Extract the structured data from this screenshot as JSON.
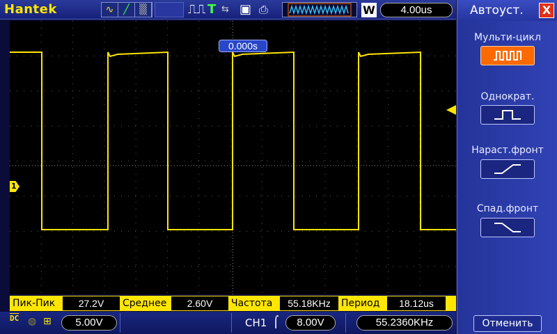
{
  "header": {
    "brand": "Hantek",
    "timebase": "4.00us",
    "wave_mode": "W",
    "icons": [
      "waveform-icon",
      "vector-icon",
      "persist-icon",
      "pulse-icon",
      "trigger-t-icon",
      "save-icon",
      "print-icon"
    ]
  },
  "screen": {
    "trigger_position": "0.000s",
    "ch1_marker": "1"
  },
  "panel": {
    "title": "Автоуст.",
    "close_label": "X",
    "modes": [
      {
        "label": "Мульти-цикл",
        "icon": "multi-cycle-icon",
        "active": true
      },
      {
        "label": "Однократ.",
        "icon": "single-pulse-icon",
        "active": false
      },
      {
        "label": "Нараст.фронт",
        "icon": "rising-edge-icon",
        "active": false
      },
      {
        "label": "Спад.фронт",
        "icon": "falling-edge-icon",
        "active": false
      }
    ],
    "cancel_label": "Отменить"
  },
  "measurements": [
    {
      "label": "Пик-Пик",
      "value": "27.2V"
    },
    {
      "label": "Среднее",
      "value": "2.60V"
    },
    {
      "label": "Частота",
      "value": "55.18KHz"
    },
    {
      "label": "Период",
      "value": "18.12us"
    }
  ],
  "status": {
    "coupling": "DC",
    "volts_div": "5.00V",
    "trigger_channel": "CH1",
    "trigger_level": "8.00V",
    "frequency": "55.2360KHz"
  },
  "colors": {
    "trace": "#ffe600",
    "accent": "#ff6a00",
    "panel": "#2a3aa6"
  }
}
